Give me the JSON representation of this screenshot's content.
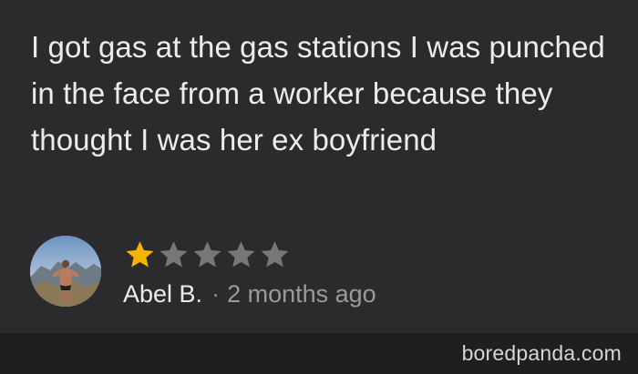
{
  "review": {
    "text": "I got gas at the gas stations I was punched in the face from a worker because they thought I was her ex boyfriend",
    "rating": 1,
    "max_rating": 5,
    "author": "Abel B.",
    "separator": "·",
    "time_ago": "2 months ago"
  },
  "watermark": "boredpanda.com",
  "colors": {
    "background": "#1f1f21",
    "card": "#2b2b2d",
    "text": "#ececec",
    "star_filled": "#f6b300",
    "star_empty": "#77777a",
    "muted": "#9a9a9c"
  },
  "icons": {
    "star": "star-icon",
    "avatar": "avatar-photo"
  }
}
